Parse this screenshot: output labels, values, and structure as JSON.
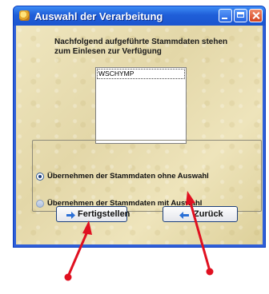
{
  "window": {
    "title": "Auswahl der Verarbeitung",
    "title_icon": "app-icon",
    "controls": [
      "minimize-icon",
      "maximize-icon",
      "close-icon"
    ]
  },
  "intro_text": "Nachfolgend aufgeführte Stammdaten stehen zum Einlesen zur Verfügung",
  "list": {
    "items": [
      "WSCHYMP"
    ],
    "selected_index": 0
  },
  "options": {
    "option1": {
      "label": "Übernehmen der Stammdaten ohne Auswahl",
      "checked": true
    },
    "option2": {
      "label": "Übernehmen der Stammdaten mit Auswahl",
      "checked": false
    }
  },
  "buttons": {
    "finish": {
      "label": "Fertigstellen",
      "icon": "arrow-right-icon"
    },
    "back": {
      "label": "Zurück",
      "icon": "arrow-left-icon"
    }
  },
  "annotation": {
    "color": "#e01020"
  }
}
